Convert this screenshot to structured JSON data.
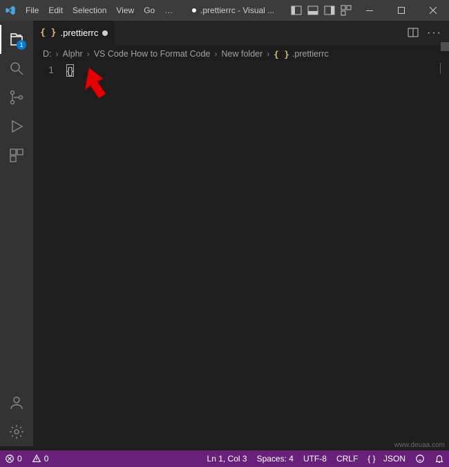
{
  "menu": {
    "file": "File",
    "edit": "Edit",
    "selection": "Selection",
    "view": "View",
    "go": "Go",
    "more": "…"
  },
  "title": ".prettierrc - Visual ...",
  "activity": {
    "explorer_badge": "1"
  },
  "tab": {
    "filename": ".prettierrc"
  },
  "breadcrumb": {
    "p0": "D:",
    "p1": "Alphr",
    "p2": "VS Code How to Format Code",
    "p3": "New folder",
    "p4": ".prettierrc"
  },
  "editor": {
    "line_no": "1",
    "line_content": "{}"
  },
  "status": {
    "errors": "0",
    "warnings": "0",
    "position": "Ln 1, Col 3",
    "spaces": "Spaces: 4",
    "encoding": "UTF-8",
    "eol": "CRLF",
    "lang_icon": "{ }",
    "lang": "JSON"
  },
  "watermark": "www.deuaa.com"
}
